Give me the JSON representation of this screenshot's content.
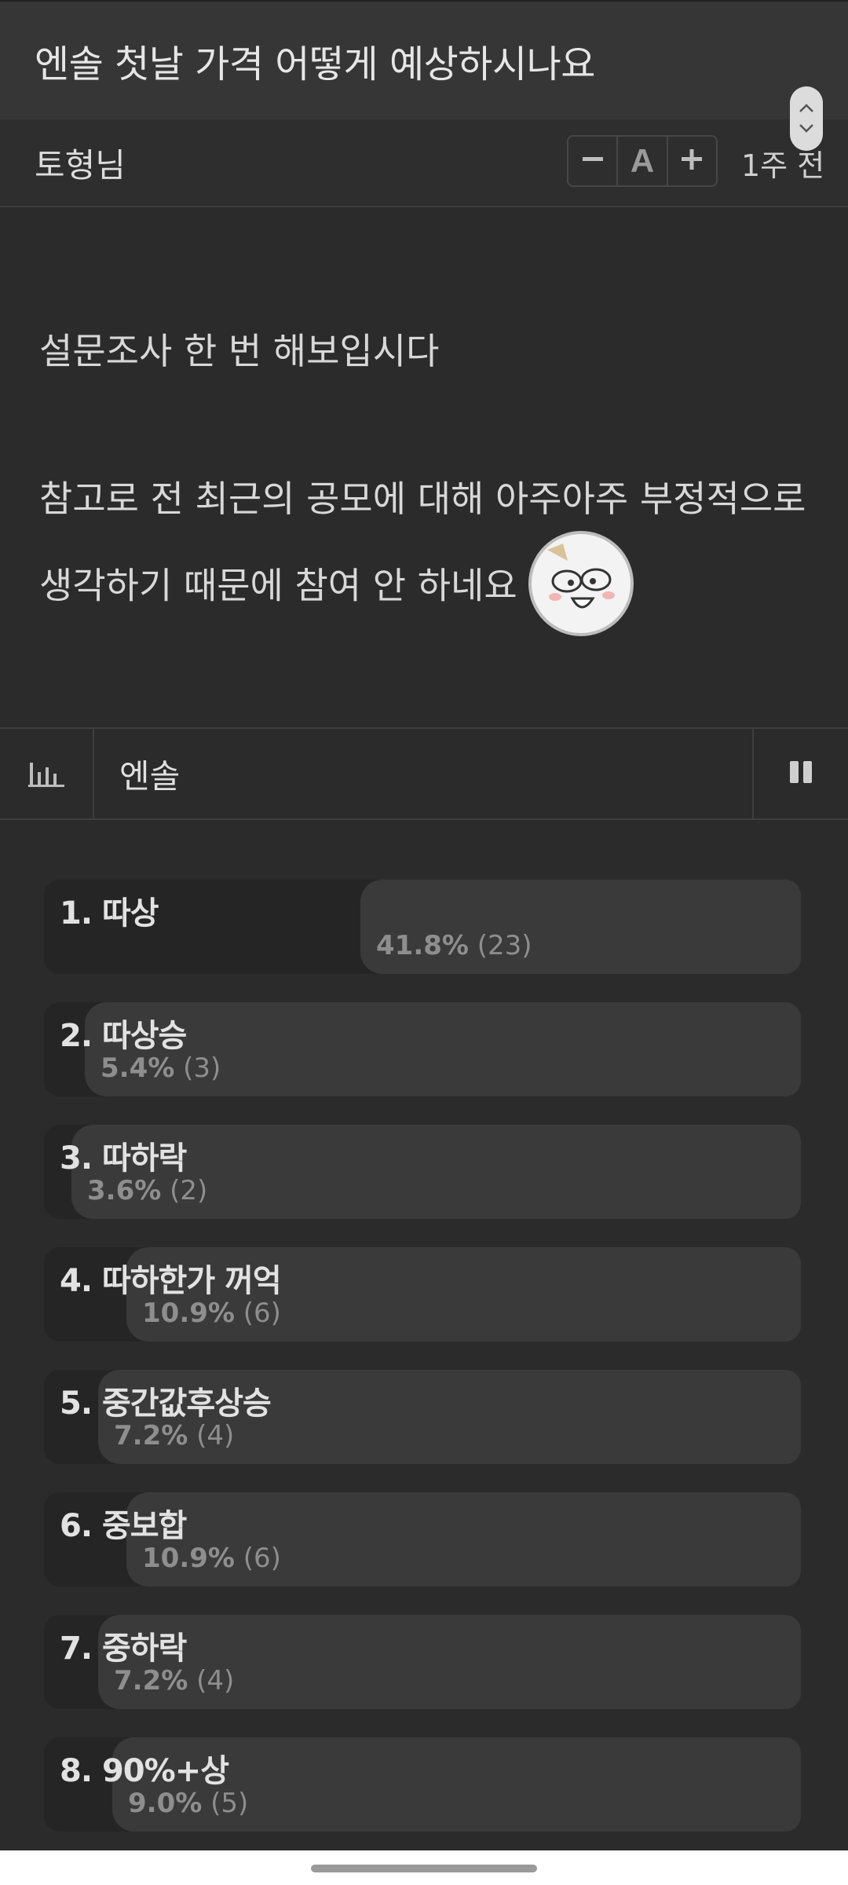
{
  "post": {
    "title": "엔솔 첫날 가격 어떻게 예상하시나요",
    "author": "토형님",
    "time_ago": "1주 전",
    "body_line1": "설문조사 한 번 해보입시다",
    "body_line2": "참고로 전 최근의 공모에 대해 아주아주 부정적으로",
    "body_line3": "생각하기 때문에 참여 안 하네요"
  },
  "font_controls": {
    "decrease_icon": "minus-icon",
    "font_icon": "font-size-icon",
    "increase_icon": "plus-icon",
    "font_letter": "A"
  },
  "poll": {
    "title": "엔솔",
    "chart_icon": "bar-chart-icon",
    "pause_icon": "pause-icon",
    "options": [
      {
        "label": "1. 따상",
        "percent": "41.8%",
        "count": "(23)",
        "fraction": 0.418
      },
      {
        "label": "2. 따상승",
        "percent": "5.4%",
        "count": "(3)",
        "fraction": 0.054
      },
      {
        "label": "3. 따하락",
        "percent": "3.6%",
        "count": "(2)",
        "fraction": 0.036
      },
      {
        "label": "4. 따하한가 꺼억",
        "percent": "10.9%",
        "count": "(6)",
        "fraction": 0.109
      },
      {
        "label": "5. 중간값후상승",
        "percent": "7.2%",
        "count": "(4)",
        "fraction": 0.072
      },
      {
        "label": "6. 중보합",
        "percent": "10.9%",
        "count": "(6)",
        "fraction": 0.109
      },
      {
        "label": "7. 중하락",
        "percent": "7.2%",
        "count": "(4)",
        "fraction": 0.072
      },
      {
        "label": "8. 90%+상",
        "percent": "9.0%",
        "count": "(5)",
        "fraction": 0.09
      }
    ]
  },
  "colors": {
    "background": "#2b2b2b",
    "title_bar": "#363636",
    "bar_fill": "#252525",
    "bar_rest": "#3a3a3a"
  }
}
